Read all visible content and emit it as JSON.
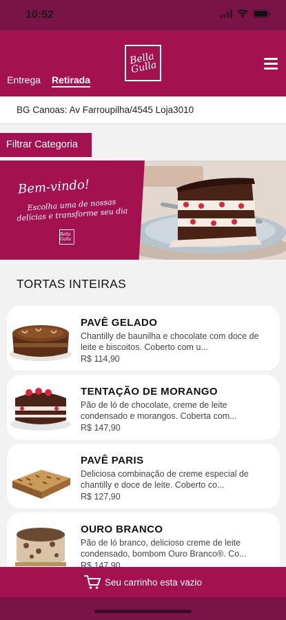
{
  "status": {
    "time": "10:52"
  },
  "header": {
    "logo_text": "Bella Gulla",
    "tabs": [
      {
        "label": "Entrega"
      },
      {
        "label": "Retirada"
      }
    ]
  },
  "store": {
    "name": "BG Canoas: Av Farroupilha/4545 Loja3010"
  },
  "filter": {
    "label": "Filtrar Categoria"
  },
  "banner": {
    "title": "Bem-vindo!",
    "subtitle": "Escolha uma de nossas delícias e transforme seu dia",
    "logo_text": "Bella Gulla"
  },
  "section": {
    "title": "TORTAS INTEIRAS"
  },
  "products": [
    {
      "name": "PAVÊ GELADO",
      "description": "Chantilly de baunilha e chocolate com doce de leite e biscoitos. Coberto com u...",
      "price": "R$ 114,90"
    },
    {
      "name": "TENTAÇÃO DE MORANGO",
      "description": "Pão de ló de chocolate, creme de leite condensado e morangos. Coberta com...",
      "price": "R$ 147,90"
    },
    {
      "name": "PAVÊ PARIS",
      "description": "Deliciosa combinação de creme especial de chantilly e doce de leite. Coberto co...",
      "price": "R$ 127,90"
    },
    {
      "name": "OURO BRANCO",
      "description": "Pão de ló branco, delicioso creme de leite condensado, bombom Ouro Branco®. Co...",
      "price": "R$ 147,90"
    }
  ],
  "cart": {
    "label": "Seu carrinho esta vazio"
  },
  "colors": {
    "brand": "#a3124f",
    "brand_dark": "#7a1446",
    "background": "#f2f2f2"
  },
  "icons": [
    "signal-icon",
    "wifi-icon",
    "battery-icon",
    "menu-icon",
    "cart-icon"
  ]
}
